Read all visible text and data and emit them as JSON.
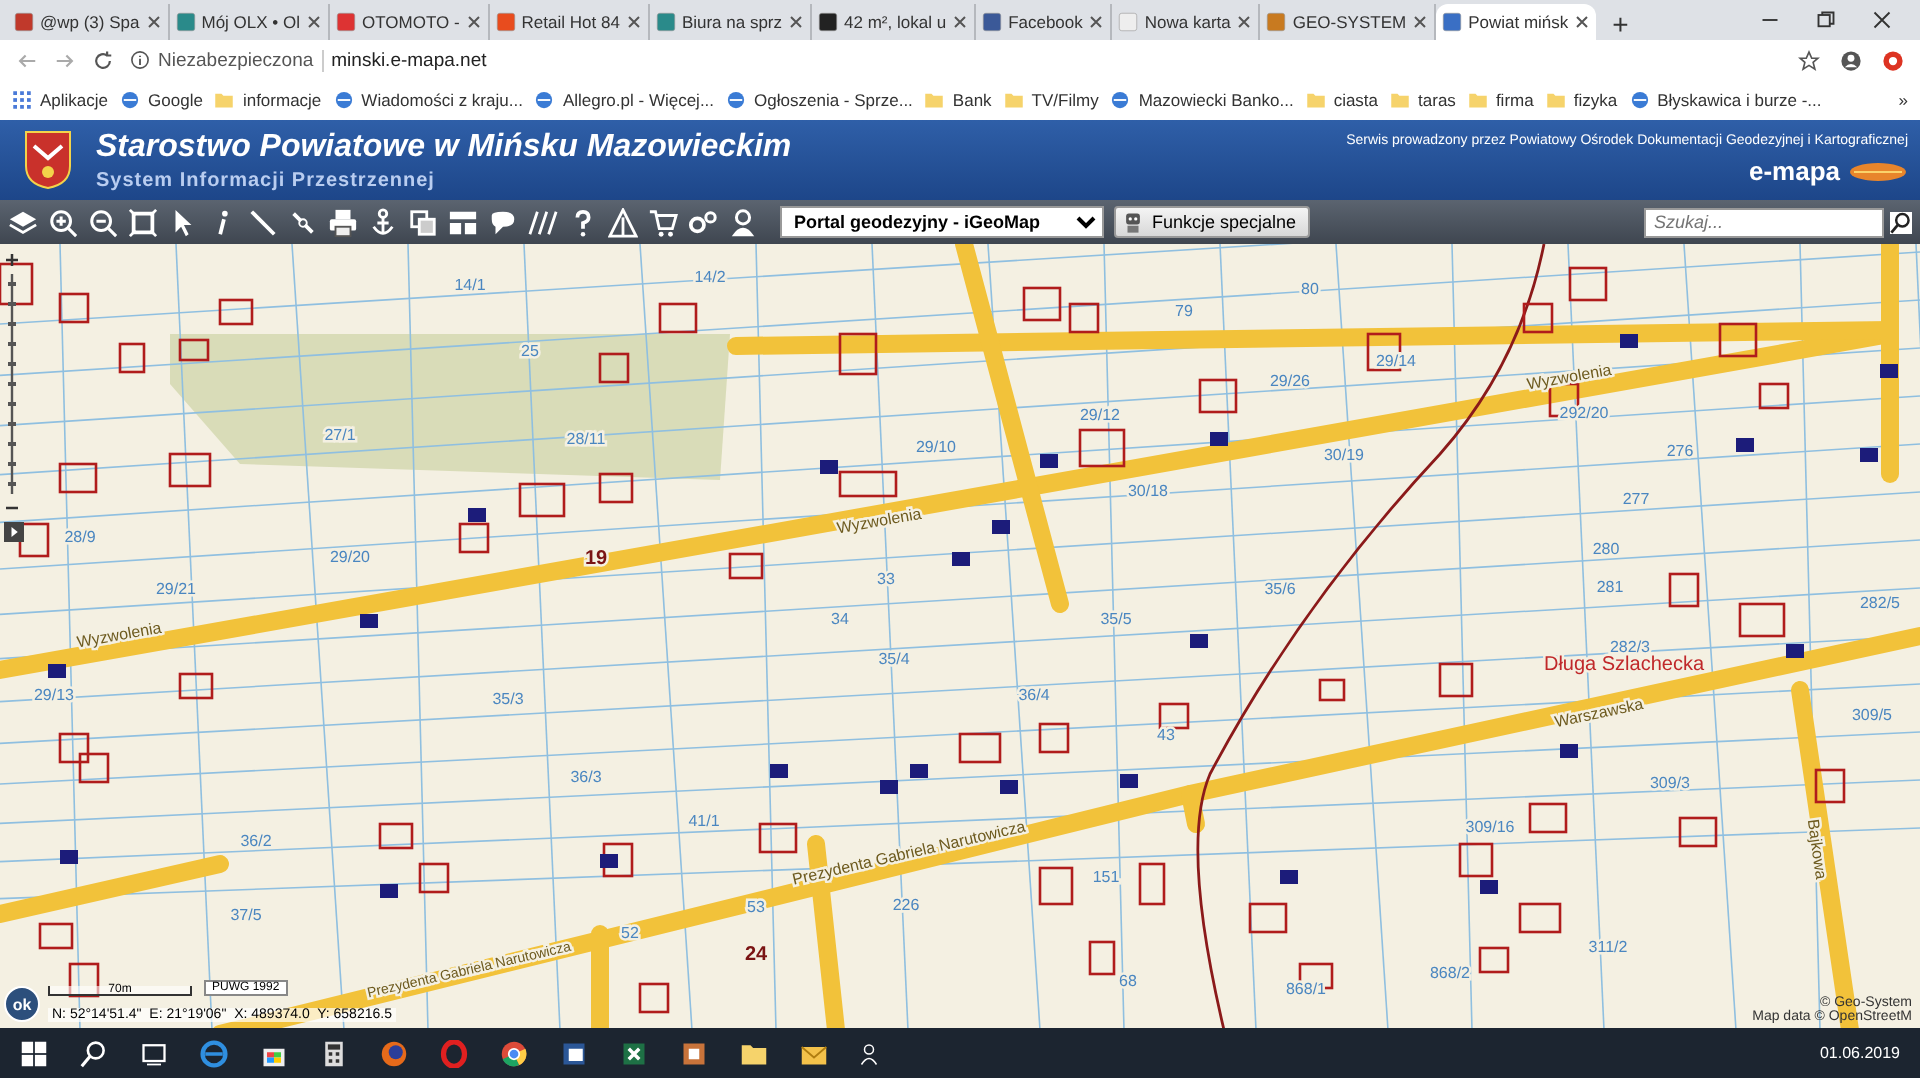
{
  "browser": {
    "tabs": [
      {
        "title": "@wp (3) Spa",
        "selected": false
      },
      {
        "title": "Mój OLX • Ol",
        "selected": false
      },
      {
        "title": "OTOMOTO -",
        "selected": false
      },
      {
        "title": "Retail Hot 84",
        "selected": false
      },
      {
        "title": "Biura na sprz",
        "selected": false
      },
      {
        "title": "42 m², lokal u",
        "selected": false
      },
      {
        "title": "Facebook",
        "selected": false
      },
      {
        "title": "Nowa karta",
        "selected": false
      },
      {
        "title": "GEO-SYSTEM",
        "selected": false
      },
      {
        "title": "Powiat mińsk",
        "selected": true
      }
    ],
    "new_tab": "+",
    "address": {
      "security": "Niezabezpieczona",
      "url": "minski.e-mapa.net"
    },
    "bookmarks": [
      {
        "label": "Aplikacje",
        "kind": "apps"
      },
      {
        "label": "Google",
        "kind": "site"
      },
      {
        "label": "informacje",
        "kind": "folder"
      },
      {
        "label": "Wiadomości z kraju...",
        "kind": "site"
      },
      {
        "label": "Allegro.pl - Więcej...",
        "kind": "site"
      },
      {
        "label": "Ogłoszenia - Sprze...",
        "kind": "site"
      },
      {
        "label": "Bank",
        "kind": "folder"
      },
      {
        "label": "TV/Filmy",
        "kind": "folder"
      },
      {
        "label": "Mazowiecki Banko...",
        "kind": "site"
      },
      {
        "label": "ciasta",
        "kind": "folder"
      },
      {
        "label": "taras",
        "kind": "folder"
      },
      {
        "label": "firma",
        "kind": "folder"
      },
      {
        "label": "fizyka",
        "kind": "folder"
      },
      {
        "label": "Błyskawica i burze -...",
        "kind": "site"
      }
    ],
    "more": "»"
  },
  "header": {
    "title": "Starostwo Powiatowe w Mińsku Mazowieckim",
    "subtitle": "System Informacji Przestrzennej",
    "service_note": "Serwis prowadzony przez Powiatowy Ośrodek Dokumentacji Geodezyjnej i Kartograficznej",
    "brand": "e-mapa"
  },
  "toolbar": {
    "portal_select": "Portal geodezyjny - iGeoMap",
    "special_button": "Funkcje specjalne",
    "search": {
      "placeholder": "Szukaj..."
    }
  },
  "map": {
    "streets": [
      "Wyzwolenia",
      "Wyzwolenia",
      "Wyzwolenia",
      "Warszawska",
      "Prezydenta Gabriela Narutowicza",
      "Prezydenta Gabriela Narutowicza",
      "Bajkowa"
    ],
    "place_name": "Długa Szlachecka",
    "house_numbers": [
      "19",
      "24"
    ],
    "parcels": [
      "14/1",
      "14/2",
      "25",
      "27/1",
      "28/11",
      "28/9",
      "29/20",
      "29/21",
      "29/10",
      "29/12",
      "79",
      "80",
      "29/26",
      "29/14",
      "30/19",
      "30/18",
      "276",
      "277",
      "280",
      "281",
      "33",
      "34",
      "35/5",
      "35/6",
      "35/4",
      "36/4",
      "282/3",
      "35/3",
      "36/3",
      "36/2",
      "41/1",
      "43",
      "309/16",
      "309/3",
      "309/5",
      "311/2",
      "868/1",
      "868/2",
      "68",
      "151",
      "226",
      "53",
      "52",
      "37/5",
      "29/13",
      "292/20",
      "282/5"
    ],
    "zoom_button": "ok",
    "scale": {
      "label": "70m",
      "projection": "PUWG 1992"
    },
    "coordinates": "N: 52°14'51.4\"  E: 21°19'06\"  X: 489374.0  Y: 658216.5",
    "attribution": [
      "© Geo-System",
      "Map data © OpenStreetM"
    ]
  },
  "taskbar": {
    "date": "01.06.2019"
  }
}
